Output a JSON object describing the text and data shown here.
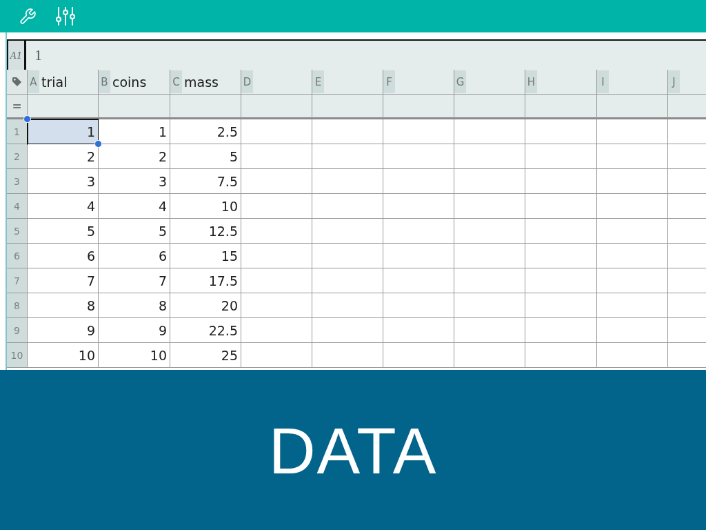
{
  "formula_bar": {
    "cell_ref": "A1",
    "value": "1"
  },
  "columns": [
    {
      "letter": "A",
      "name": "trial"
    },
    {
      "letter": "B",
      "name": "coins"
    },
    {
      "letter": "C",
      "name": "mass"
    },
    {
      "letter": "D"
    },
    {
      "letter": "E"
    },
    {
      "letter": "F"
    },
    {
      "letter": "G"
    },
    {
      "letter": "H"
    },
    {
      "letter": "I"
    },
    {
      "letter": "J"
    }
  ],
  "formula_row": {
    "marker": "="
  },
  "rows": [
    {
      "number": "1",
      "cells": [
        {
          "value": "1",
          "selected": true
        },
        {
          "value": "1",
          "selected": false
        },
        {
          "value": "2.5",
          "selected": false
        }
      ]
    },
    {
      "number": "2",
      "cells": [
        {
          "value": "2",
          "selected": false
        },
        {
          "value": "2",
          "selected": false
        },
        {
          "value": "5",
          "selected": false
        }
      ]
    },
    {
      "number": "3",
      "cells": [
        {
          "value": "3",
          "selected": false
        },
        {
          "value": "3",
          "selected": false
        },
        {
          "value": "7.5",
          "selected": false
        }
      ]
    },
    {
      "number": "4",
      "cells": [
        {
          "value": "4",
          "selected": false
        },
        {
          "value": "4",
          "selected": false
        },
        {
          "value": "10",
          "selected": false
        }
      ]
    },
    {
      "number": "5",
      "cells": [
        {
          "value": "5",
          "selected": false
        },
        {
          "value": "5",
          "selected": false
        },
        {
          "value": "12.5",
          "selected": false
        }
      ]
    },
    {
      "number": "6",
      "cells": [
        {
          "value": "6",
          "selected": false
        },
        {
          "value": "6",
          "selected": false
        },
        {
          "value": "15",
          "selected": false
        }
      ]
    },
    {
      "number": "7",
      "cells": [
        {
          "value": "7",
          "selected": false
        },
        {
          "value": "7",
          "selected": false
        },
        {
          "value": "17.5",
          "selected": false
        }
      ]
    },
    {
      "number": "8",
      "cells": [
        {
          "value": "8",
          "selected": false
        },
        {
          "value": "8",
          "selected": false
        },
        {
          "value": "20",
          "selected": false
        }
      ]
    },
    {
      "number": "9",
      "cells": [
        {
          "value": "9",
          "selected": false
        },
        {
          "value": "9",
          "selected": false
        },
        {
          "value": "22.5",
          "selected": false
        }
      ]
    },
    {
      "number": "10",
      "cells": [
        {
          "value": "10",
          "selected": false
        },
        {
          "value": "10",
          "selected": false
        },
        {
          "value": "25",
          "selected": false
        }
      ]
    }
  ],
  "banner": {
    "title": "DATA"
  }
}
